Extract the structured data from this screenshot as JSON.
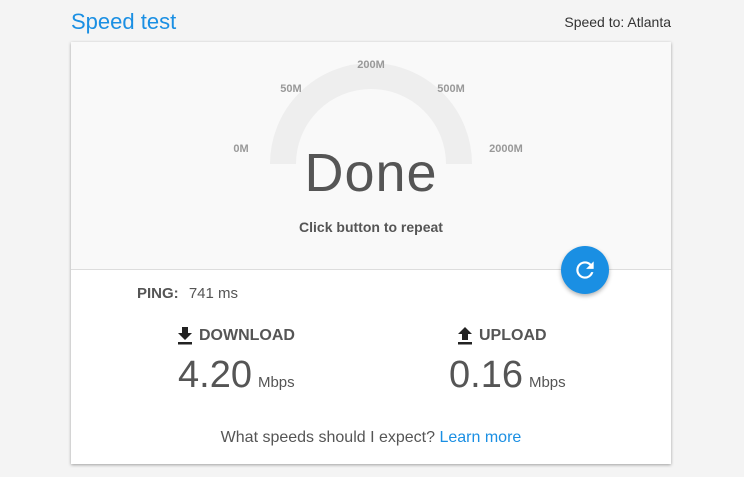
{
  "header": {
    "title": "Speed test",
    "speed_to": "Speed to: Atlanta"
  },
  "gauge": {
    "ticks": [
      "0M",
      "50M",
      "200M",
      "500M",
      "2000M"
    ],
    "status": "Done",
    "hint": "Click button to repeat"
  },
  "results": {
    "ping_label": "PING:",
    "ping_value": "741 ms",
    "download_label": "DOWNLOAD",
    "download_value": "4.20",
    "download_unit": "Mbps",
    "upload_label": "UPLOAD",
    "upload_value": "0.16",
    "upload_unit": "Mbps"
  },
  "footer": {
    "question": "What speeds should I expect?",
    "learn_more": "Learn more"
  },
  "colors": {
    "accent": "#1a8fe3",
    "gauge_track": "#eeeeee"
  },
  "icons": {
    "repeat": "refresh-icon",
    "download": "download-icon",
    "upload": "upload-icon"
  }
}
